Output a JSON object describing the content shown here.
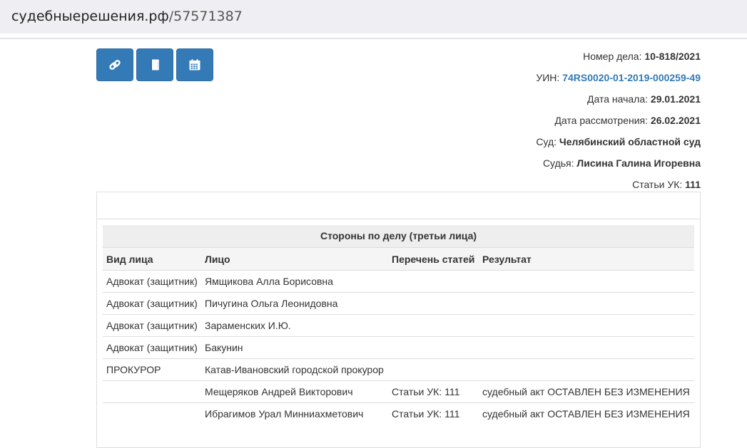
{
  "browser": {
    "url_host": "судебныерешения.рф",
    "url_path": "/57571387"
  },
  "toolbar": {
    "buttons": [
      {
        "icon": "link-icon"
      },
      {
        "icon": "book-icon"
      },
      {
        "icon": "calendar-icon"
      }
    ]
  },
  "case": {
    "number_label": "Номер дела:",
    "number_value": "10-818/2021",
    "uin_label": "УИН:",
    "uin_value": "74RS0020-01-2019-000259-49",
    "start_label": "Дата начала:",
    "start_value": "29.01.2021",
    "review_label": "Дата рассмотрения:",
    "review_value": "26.02.2021",
    "court_label": "Суд:",
    "court_value": "Челябинский областной суд",
    "judge_label": "Судья:",
    "judge_value": "Лисина Галина Игоревна",
    "articles_label": "Статьи УК:",
    "articles_value": "111"
  },
  "parties": {
    "title": "Стороны по делу (третьи лица)",
    "columns": [
      "Вид лица",
      "Лицо",
      "Перечень статей",
      "Результат"
    ],
    "rows": [
      [
        "Адвокат (защитник)",
        "Ямщикова Алла Борисовна",
        "",
        ""
      ],
      [
        "Адвокат (защитник)",
        "Пичугина Ольга Леонидовна",
        "",
        ""
      ],
      [
        "Адвокат (защитник)",
        "Зараменских И.Ю.",
        "",
        ""
      ],
      [
        "Адвокат (защитник)",
        "Бакунин",
        "",
        ""
      ],
      [
        "ПРОКУРОР",
        "Катав-Ивановский городской прокурор",
        "",
        ""
      ],
      [
        "",
        "Мещеряков Андрей Викторович",
        "Статьи УК: 111",
        "судебный акт ОСТАВЛЕН БЕЗ ИЗМЕНЕНИЯ"
      ],
      [
        "",
        "Ибрагимов Урал Минниахметович",
        "Статьи УК: 111",
        "судебный акт ОСТАВЛЕН БЕЗ ИЗМЕНЕНИЯ"
      ]
    ]
  },
  "colors": {
    "primary": "#337ab7",
    "link": "#337ab7",
    "caption_bg": "#eeeeee",
    "header_bg": "#f5f5f5",
    "url_bar_bg": "#efeff3"
  }
}
